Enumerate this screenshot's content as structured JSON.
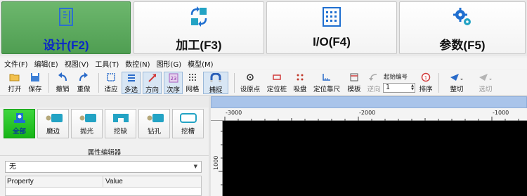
{
  "mode_tabs": [
    {
      "label": "设计(F2)",
      "icon": "design-ruler-icon",
      "active": true
    },
    {
      "label": "加工(F3)",
      "icon": "process-arrows-icon",
      "active": false
    },
    {
      "label": "I/O(F4)",
      "icon": "io-grid-icon",
      "active": false
    },
    {
      "label": "参数(F5)",
      "icon": "gears-icon",
      "active": false
    }
  ],
  "menu": [
    "文件(F)",
    "编辑(E)",
    "视图(V)",
    "工具(T)",
    "数控(N)",
    "图形(G)",
    "模型(M)"
  ],
  "toolbar": {
    "open": "打开",
    "save": "保存",
    "undo": "撤销",
    "redo": "重做",
    "fit": "适应",
    "multiselect": "多选",
    "direction": "方向",
    "order": "次序",
    "grid": "网格",
    "snap": "捕捉",
    "set_origin": "设原点",
    "locate_pile": "定位桩",
    "suction": "吸盘",
    "locate_ruler": "定位靠尺",
    "template": "模板",
    "reverse": "逆向",
    "start_number_title": "起始编号",
    "start_number_value": "1",
    "sort": "排序",
    "whole_cut": "整切",
    "select_cut": "选切"
  },
  "categories": [
    {
      "label": "全部",
      "icon": "all-parts-icon",
      "active": true
    },
    {
      "label": "磨边",
      "icon": "edge-grind-icon",
      "active": false
    },
    {
      "label": "抛光",
      "icon": "polish-icon",
      "active": false
    },
    {
      "label": "挖缺",
      "icon": "notch-icon",
      "active": false
    },
    {
      "label": "钻孔",
      "icon": "drill-icon",
      "active": false
    },
    {
      "label": "挖槽",
      "icon": "groove-icon",
      "active": false
    }
  ],
  "property_editor": {
    "title": "属性编辑器",
    "combo_value": "无",
    "columns": [
      "Property",
      "Value"
    ]
  },
  "ruler": {
    "h_labels": [
      "-3000",
      "-2000",
      "-1000"
    ],
    "v_labels": [
      "1000"
    ]
  },
  "colors": {
    "active_tab": "#56a459",
    "active_tab_label": "#0a28c8",
    "active_category": "#22bf22",
    "canvas": "#000000",
    "canvas_strip": "#a9c4ea",
    "icon_blue": "#1f6fd0",
    "icon_teal": "#23a3c4"
  }
}
